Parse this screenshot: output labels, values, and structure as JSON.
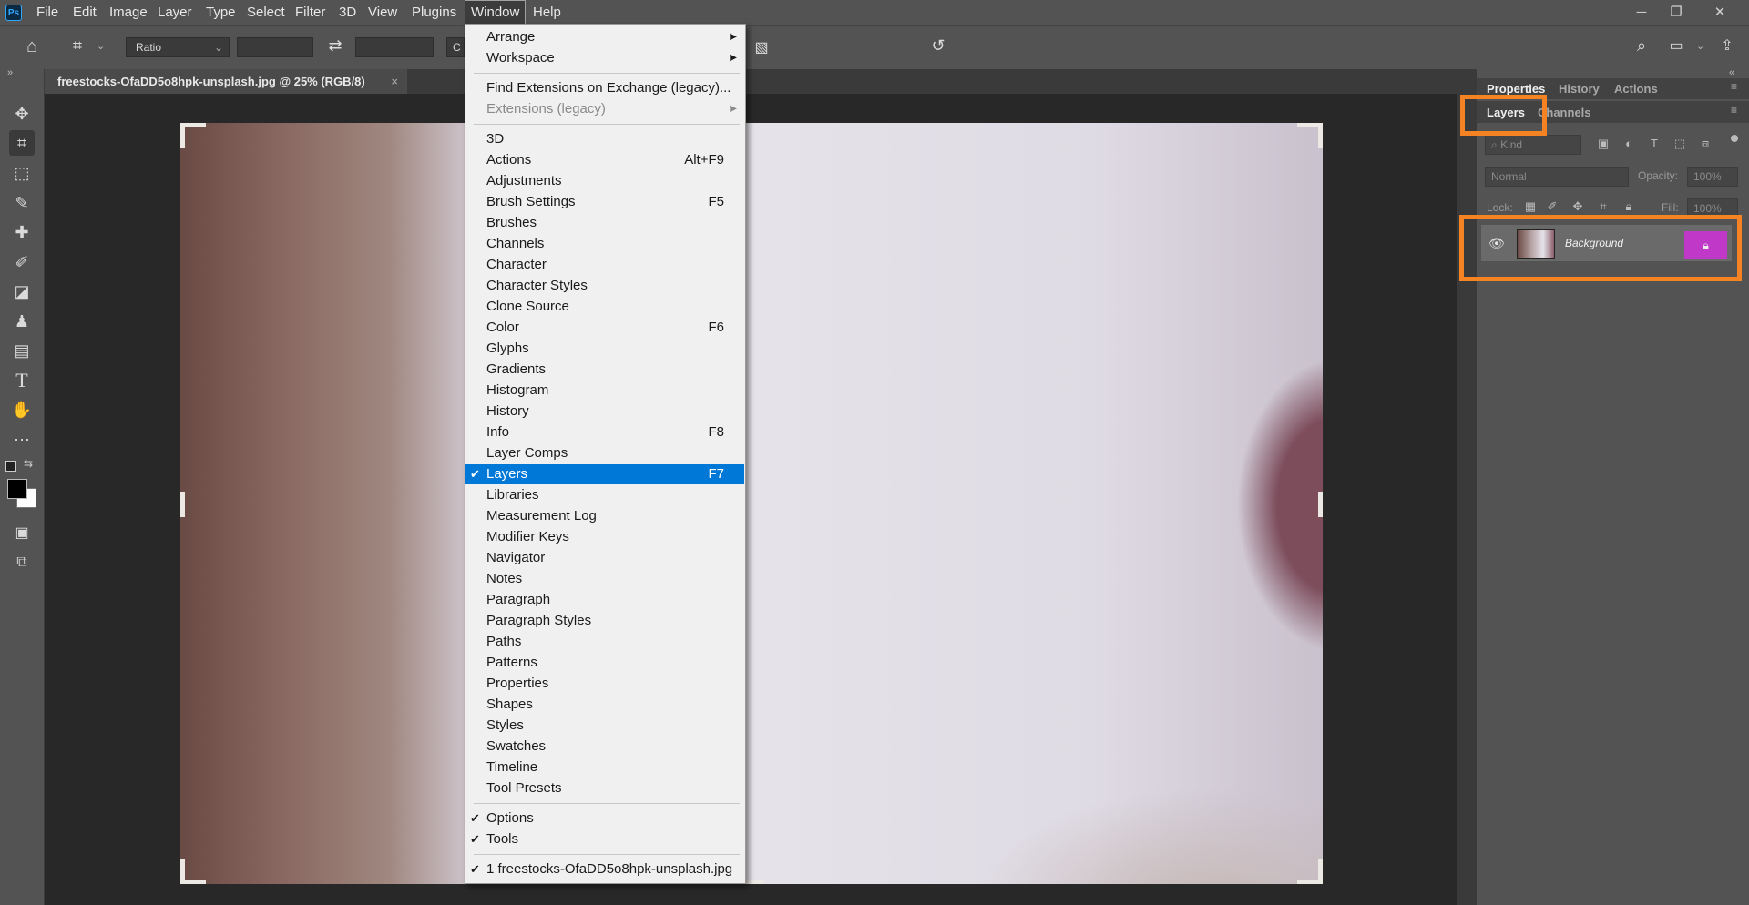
{
  "app": {
    "logo_text": "Ps"
  },
  "menubar": {
    "items": [
      "File",
      "Edit",
      "Image",
      "Layer",
      "Type",
      "Select",
      "Filter",
      "3D",
      "View",
      "Plugins",
      "Window",
      "Help"
    ],
    "active": "Window"
  },
  "options_bar": {
    "ratio_label": "Ratio",
    "width_value": "",
    "height_value": "",
    "partial_button_text": "C"
  },
  "document": {
    "tab_title": "freestocks-OfaDD5o8hpk-unsplash.jpg @ 25% (RGB/8)",
    "close_symbol": "×"
  },
  "window_menu": {
    "groups": [
      [
        {
          "label": "Arrange",
          "submenu": true
        },
        {
          "label": "Workspace",
          "submenu": true
        }
      ],
      [
        {
          "label": "Find Extensions on Exchange (legacy)..."
        },
        {
          "label": "Extensions (legacy)",
          "submenu": true,
          "disabled": true
        }
      ],
      [
        {
          "label": "3D"
        },
        {
          "label": "Actions",
          "shortcut": "Alt+F9"
        },
        {
          "label": "Adjustments"
        },
        {
          "label": "Brush Settings",
          "shortcut": "F5"
        },
        {
          "label": "Brushes"
        },
        {
          "label": "Channels"
        },
        {
          "label": "Character"
        },
        {
          "label": "Character Styles"
        },
        {
          "label": "Clone Source"
        },
        {
          "label": "Color",
          "shortcut": "F6"
        },
        {
          "label": "Glyphs"
        },
        {
          "label": "Gradients"
        },
        {
          "label": "Histogram"
        },
        {
          "label": "History"
        },
        {
          "label": "Info",
          "shortcut": "F8"
        },
        {
          "label": "Layer Comps"
        },
        {
          "label": "Layers",
          "shortcut": "F7",
          "checked": true,
          "highlighted": true
        },
        {
          "label": "Libraries"
        },
        {
          "label": "Measurement Log"
        },
        {
          "label": "Modifier Keys"
        },
        {
          "label": "Navigator"
        },
        {
          "label": "Notes"
        },
        {
          "label": "Paragraph"
        },
        {
          "label": "Paragraph Styles"
        },
        {
          "label": "Paths"
        },
        {
          "label": "Patterns"
        },
        {
          "label": "Properties"
        },
        {
          "label": "Shapes"
        },
        {
          "label": "Styles"
        },
        {
          "label": "Swatches"
        },
        {
          "label": "Timeline"
        },
        {
          "label": "Tool Presets"
        }
      ],
      [
        {
          "label": "Options",
          "checked": true
        },
        {
          "label": "Tools",
          "checked": true
        }
      ],
      [
        {
          "label": "1 freestocks-OfaDD5o8hpk-unsplash.jpg",
          "checked": true
        }
      ]
    ]
  },
  "panels": {
    "top_tabs": [
      "Properties",
      "History",
      "Actions"
    ],
    "layer_tabs": [
      "Layers",
      "Channels"
    ],
    "kind_placeholder": "Kind",
    "blend_mode": "Normal",
    "opacity_label": "Opacity:",
    "opacity_value": "100%",
    "lock_label": "Lock:",
    "fill_label": "Fill:",
    "fill_value": "100%",
    "layers": [
      {
        "name": "Background",
        "visible": true,
        "locked": true
      }
    ]
  },
  "colors": {
    "highlight": "#0078d7",
    "annotation_orange": "#f58223",
    "annotation_magenta": "#c038c8"
  }
}
